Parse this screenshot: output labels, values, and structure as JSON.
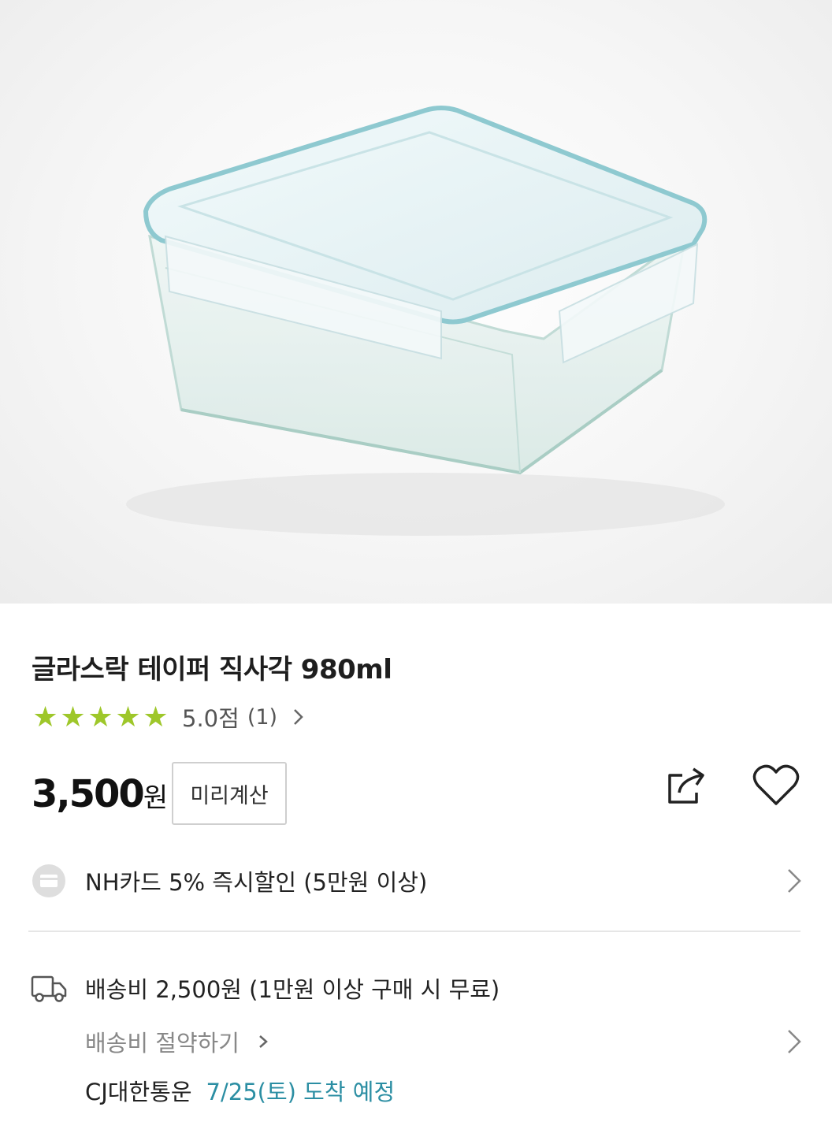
{
  "product": {
    "title": "글라스락 테이퍼 직사각 980ml",
    "rating": {
      "stars": 5,
      "max_stars": 5,
      "score_text": "5.0점",
      "count_text": "(1)",
      "star_color": "#9ec72a"
    },
    "price": {
      "amount": "3,500",
      "unit": "원"
    },
    "precalc_label": "미리계산"
  },
  "actions": {
    "share_icon": "share-icon",
    "wishlist_icon": "heart-icon"
  },
  "card_benefit": {
    "icon": "card-icon",
    "text": "NH카드 5% 즉시할인 (5만원 이상)"
  },
  "shipping": {
    "icon": "truck-icon",
    "fee_text": "배송비 2,500원 (1만원 이상 구매 시 무료)",
    "save_text": "배송비 절약하기",
    "courier": "CJ대한통운",
    "eta": "7/25(토) 도착 예정",
    "eta_color": "#2b8ea3"
  }
}
